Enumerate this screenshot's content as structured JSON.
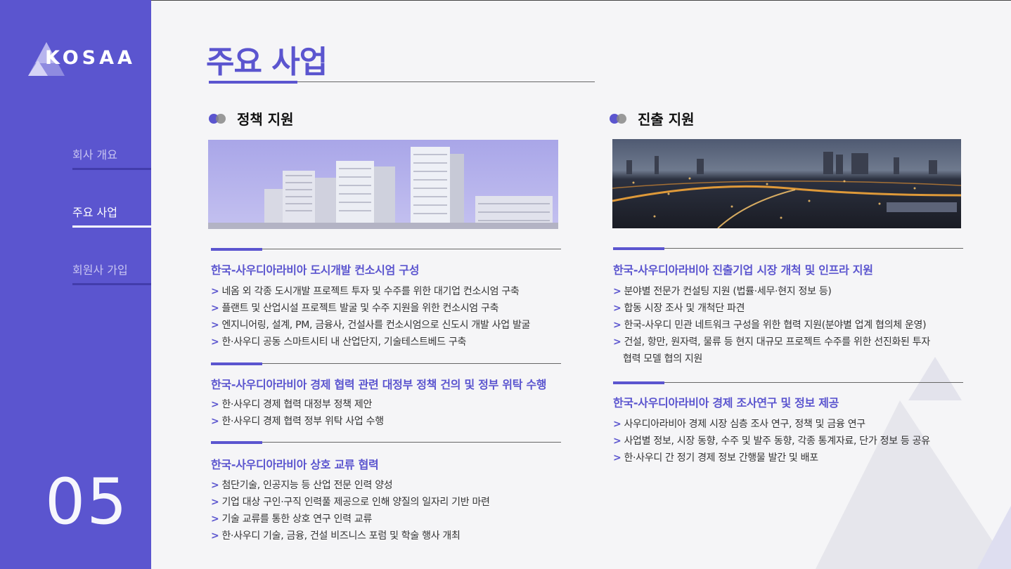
{
  "sidebar": {
    "logo_text": "KOSAA",
    "nav": [
      {
        "label": "회사 개요"
      },
      {
        "label": "주요 사업"
      },
      {
        "label": "회원사 가입"
      }
    ],
    "page_number": "05"
  },
  "main": {
    "title": "주요 사업",
    "left": {
      "section_title": "정책 지원",
      "blocks": [
        {
          "heading": "한국-사우디아라비아 도시개발 컨소시엄 구성",
          "items": [
            "네옴 외 각종 도시개발 프로젝트 투자 및 수주를 위한 대기업 컨소시엄 구축",
            "플랜트 및 산업시설 프로젝트 발굴 및 수주 지원을 위한 컨소시엄 구축",
            "엔지니어링, 설계, PM, 금융사, 건설사를 컨소시엄으로 신도시 개발 사업 발굴",
            "한·사우디 공동 스마트시티 내 산업단지, 기술테스트베드 구축"
          ]
        },
        {
          "heading": "한국-사우디아라비아 경제 협력 관련 대정부 정책 건의 및 정부 위탁 수행",
          "items": [
            "한·사우디 경제 협력 대정부 정책 제안",
            "한·사우디 경제 협력 정부 위탁 사업 수행"
          ]
        },
        {
          "heading": "한국-사우디아라비아 상호 교류 협력",
          "items": [
            "첨단기술, 인공지능 등 산업 전문 인력 양성",
            "기업 대상 구인·구직 인력풀 제공으로 인해 양질의 일자리 기반 마련",
            "기술 교류를 통한 상호 연구 인력 교류",
            "한·사우디 기술, 금융, 건설 비즈니스 포럼 및 학술 행사 개최"
          ]
        }
      ]
    },
    "right": {
      "section_title": "진출 지원",
      "blocks": [
        {
          "heading": "한국-사우디아라비아 진출기업 시장 개척 및 인프라 지원",
          "items": [
            "분야별 전문가 컨설팅 지원 (법률·세무·현지 정보 등)",
            "합동 시장 조사 및 개척단 파견",
            "한국-사우디 민관 네트워크 구성을 위한 협력 지원(분야별 업계 협의체 운영)",
            "건설, 항만, 원자력, 물류 등 현지 대규모 프로젝트 수주를 위한 선진화된 투자"
          ],
          "item_continuation": "협력 모델 협의 지원"
        },
        {
          "heading": "한국-사우디아라비아 경제 조사연구 및 정보 제공",
          "items": [
            "사우디아라비아 경제 시장 심층 조사 연구, 정책 및 금융 연구",
            "사업별 정보, 시장 동향, 수주 및 발주 동향, 각종 통계자료, 단가 정보 등 공유",
            "한·사우디 간 정기 경제 정보 간행물 발간 및 배포"
          ]
        }
      ]
    },
    "bullet_marker": ">"
  },
  "colors": {
    "accent": "#5b55cf",
    "sidebar_bg": "#5b55cf",
    "page_bg": "#f5f5f7"
  }
}
